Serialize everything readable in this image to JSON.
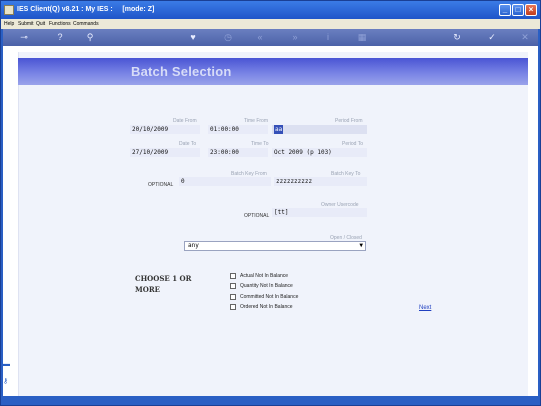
{
  "window": {
    "title": "IES Client(Q) v8.21 : My IES :     [mode: Z]",
    "controls": {
      "minimize": "_",
      "maximize": "□",
      "close": "×"
    }
  },
  "menu": [
    "Help",
    "Submit",
    "Quit",
    "Functions",
    "Commands"
  ],
  "toolbar": {
    "icons": [
      "key-icon",
      "help-icon",
      "search-icon",
      "heart-icon",
      "clock-icon",
      "rewind-icon",
      "fast-forward-icon",
      "info-icon",
      "grid-icon",
      "refresh-icon",
      "check-icon",
      "close-icon"
    ],
    "glyphs": {
      "key": "⊸",
      "help": "?",
      "search": "⚲",
      "heart": "♥",
      "clock": "◷",
      "rewind": "«",
      "forward": "»",
      "info": "i",
      "grid": "▦",
      "refresh": "↻",
      "check": "✓",
      "close": "✕"
    }
  },
  "page": {
    "heading": "Batch Selection",
    "labels": {
      "date_from": "Date From",
      "time_from": "Time From",
      "period_from": "Period From",
      "date_to": "Date To",
      "time_to": "Time To",
      "period_to": "Period To",
      "batch_key_from": "Batch Key From",
      "batch_key_to": "Batch Key To",
      "owner_userCode": "Owner Usercode",
      "open_closed": "Open / Closed",
      "optional1": "OPTIONAL",
      "optional2": "OPTIONAL"
    },
    "values": {
      "date_from": "20/10/2009",
      "time_from": "01:00:00",
      "period_from": "aa",
      "date_to": "27/10/2009",
      "time_to": "23:00:00",
      "period_to": "Oct 2009 (p 103)",
      "batch_key_from": "0",
      "batch_key_to": "zzzzzzzzzz",
      "owner_userCode": "[tt]",
      "open_closed": "any"
    },
    "choose_line1": "CHOOSE 1 OR",
    "choose_line2": "MORE",
    "checkboxes": [
      {
        "label": "Actual Not In Balance",
        "checked": false
      },
      {
        "label": "Quantity Not In Balance",
        "checked": false
      },
      {
        "label": "Committed Not In Balance",
        "checked": false
      },
      {
        "label": "Ordered Not In Balance",
        "checked": false
      }
    ],
    "next_label": "Next"
  },
  "colors": {
    "accent": "#2a5fc4",
    "header_band": "#5a65dc",
    "field_bg": "#e8ebf8",
    "link": "#2040c0"
  }
}
